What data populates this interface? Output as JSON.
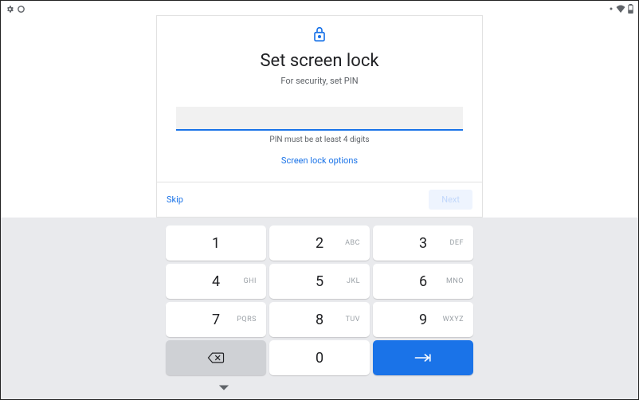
{
  "status": {
    "left_icons": [
      "gear-icon",
      "circle-icon"
    ],
    "right_icons": [
      "dot-icon",
      "wifi-icon",
      "battery-icon"
    ]
  },
  "card": {
    "title": "Set screen lock",
    "subtitle": "For security, set PIN",
    "pin_value": "",
    "hint": "PIN must be at least 4 digits",
    "options_link": "Screen lock options",
    "skip": "Skip",
    "next": "Next"
  },
  "keypad": {
    "rows": [
      [
        {
          "d": "1",
          "l": ""
        },
        {
          "d": "2",
          "l": "ABC"
        },
        {
          "d": "3",
          "l": "DEF"
        }
      ],
      [
        {
          "d": "4",
          "l": "GHI"
        },
        {
          "d": "5",
          "l": "JKL"
        },
        {
          "d": "6",
          "l": "MNO"
        }
      ],
      [
        {
          "d": "7",
          "l": "PQRS"
        },
        {
          "d": "8",
          "l": "TUV"
        },
        {
          "d": "9",
          "l": "WXYZ"
        }
      ]
    ],
    "zero": {
      "d": "0",
      "l": ""
    }
  }
}
